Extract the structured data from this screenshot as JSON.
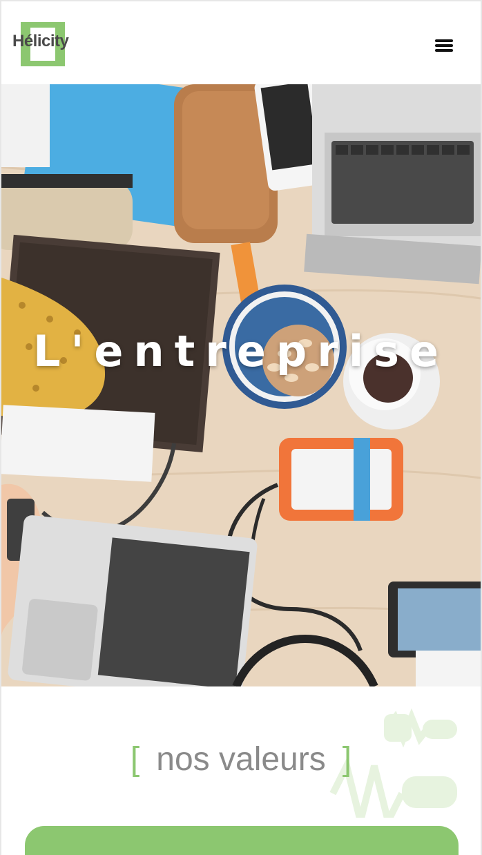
{
  "header": {
    "logo_text": "Hélicity",
    "menu_label": "menu"
  },
  "hero": {
    "title": "L'entreprise"
  },
  "values": {
    "bracket_open": "[",
    "title": "nos valeurs",
    "bracket_close": "]"
  },
  "colors": {
    "accent": "#8cc770",
    "text_gray": "#8a8a8a"
  },
  "icons": {
    "menu": "hamburger-icon"
  }
}
